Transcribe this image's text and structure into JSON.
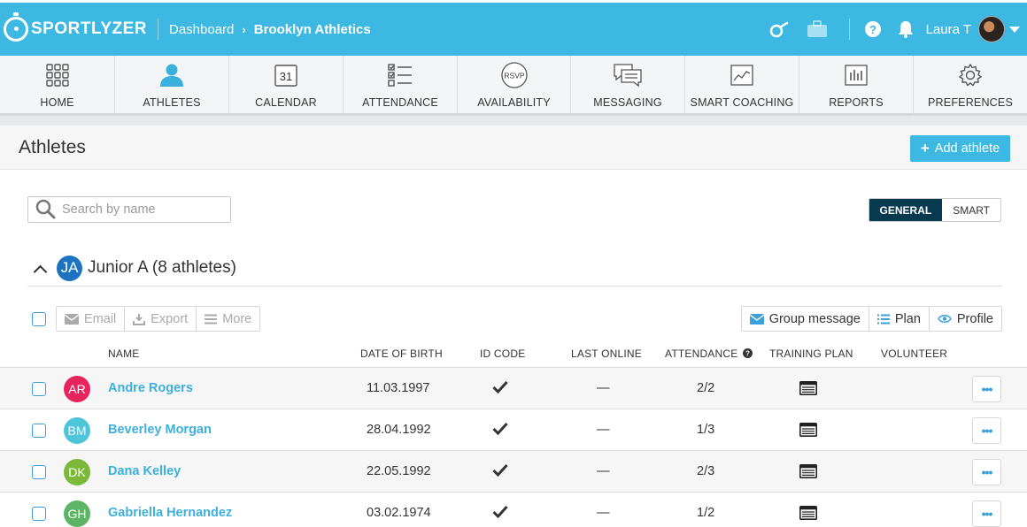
{
  "header": {
    "logo": "SPORTLYZER",
    "breadcrumb": [
      "Dashboard",
      "Brooklyn Athletics"
    ],
    "username": "Laura T",
    "icons": [
      "whistle-icon",
      "briefcase-icon",
      "help-icon",
      "bell-icon",
      "chevron-down-icon"
    ]
  },
  "nav": [
    {
      "label": "HOME",
      "icon": "grid-icon"
    },
    {
      "label": "ATHLETES",
      "icon": "person-icon"
    },
    {
      "label": "CALENDAR",
      "icon": "calendar-icon",
      "icon_text": "31"
    },
    {
      "label": "ATTENDANCE",
      "icon": "checklist-icon"
    },
    {
      "label": "AVAILABILITY",
      "icon": "rsvp-icon",
      "icon_text": "RSVP"
    },
    {
      "label": "MESSAGING",
      "icon": "chat-icon"
    },
    {
      "label": "SMART COACHING",
      "icon": "chart-icon"
    },
    {
      "label": "REPORTS",
      "icon": "bars-icon"
    },
    {
      "label": "PREFERENCES",
      "icon": "gear-icon"
    }
  ],
  "page": {
    "title": "Athletes",
    "add_button": "Add athlete",
    "search_placeholder": "Search by name",
    "view_toggle": {
      "active": "GENERAL",
      "inactive": "SMART"
    }
  },
  "group": {
    "initials": "JA",
    "title": "Junior A (8 athletes)",
    "badge_color": "#1c74c1"
  },
  "toolbar": {
    "left": [
      "Email",
      "Export",
      "More"
    ],
    "right": [
      "Group message",
      "Plan",
      "Profile"
    ]
  },
  "columns": {
    "name": "NAME",
    "dob": "DATE OF BIRTH",
    "id_code": "ID CODE",
    "last_online": "LAST ONLINE",
    "attendance": "ATTENDANCE",
    "training_plan": "TRAINING PLAN",
    "volunteer": "VOLUNTEER"
  },
  "rows": [
    {
      "initials": "AR",
      "name": "Andre Rogers",
      "dob": "11.03.1997",
      "last_online": "—",
      "attendance": "2/2",
      "color": "#e8245e"
    },
    {
      "initials": "BM",
      "name": "Beverley Morgan",
      "dob": "28.04.1992",
      "last_online": "—",
      "attendance": "1/3",
      "color": "#4fc5d9"
    },
    {
      "initials": "DK",
      "name": "Dana Kelley",
      "dob": "22.05.1992",
      "last_online": "—",
      "attendance": "2/3",
      "color": "#7cb93a"
    },
    {
      "initials": "GH",
      "name": "Gabriella Hernandez",
      "dob": "03.02.1974",
      "last_online": "—",
      "attendance": "1/2",
      "color": "#5bb564"
    }
  ],
  "more_dots": "•••",
  "colors": {
    "brand": "#3cb8e3",
    "link": "#3cb0dc",
    "dark_toggle": "#073a4f"
  }
}
